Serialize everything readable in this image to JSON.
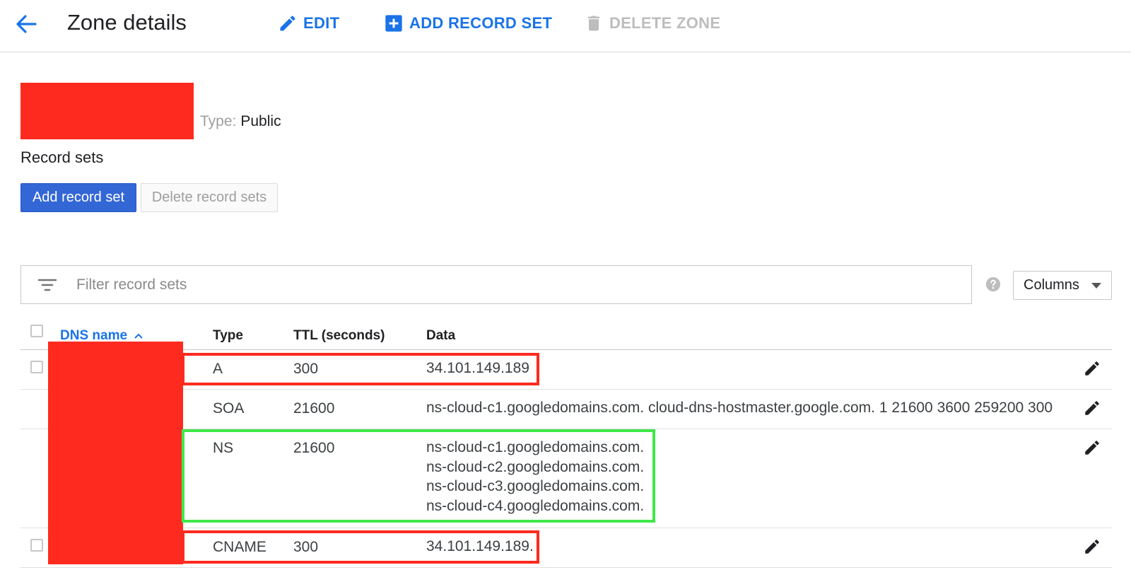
{
  "header": {
    "title": "Zone details",
    "actions": {
      "edit": "EDIT",
      "add_record_set": "ADD RECORD SET",
      "delete_zone": "DELETE ZONE"
    }
  },
  "zone": {
    "type_label": "Type:",
    "type_value": "Public"
  },
  "record_sets": {
    "title": "Record sets",
    "add_button": "Add record set",
    "delete_button": "Delete record sets",
    "filter_placeholder": "Filter record sets",
    "columns_button": "Columns",
    "headers": {
      "dns_name": "DNS name",
      "type": "Type",
      "ttl": "TTL (seconds)",
      "data": "Data"
    },
    "rows": [
      {
        "type": "A",
        "ttl": "300",
        "data": [
          "34.101.149.189"
        ]
      },
      {
        "type": "SOA",
        "ttl": "21600",
        "data": [
          "ns-cloud-c1.googledomains.com. cloud-dns-hostmaster.google.com. 1 21600 3600 259200 300"
        ]
      },
      {
        "type": "NS",
        "ttl": "21600",
        "data": [
          "ns-cloud-c1.googledomains.com.",
          "ns-cloud-c2.googledomains.com.",
          "ns-cloud-c3.googledomains.com.",
          "ns-cloud-c4.googledomains.com."
        ]
      },
      {
        "type": "CNAME",
        "ttl": "300",
        "data": [
          "34.101.149.189."
        ]
      }
    ]
  },
  "colors": {
    "accent": "#1a73e8",
    "primary_button": "#3367d6",
    "redaction": "#ff2a1f",
    "highlight_red": "#ff2a1f",
    "highlight_green": "#3fe84a"
  },
  "icons": {
    "back": "arrow-back-icon",
    "edit": "pencil-icon",
    "add": "add-box-icon",
    "delete": "trash-icon",
    "filter": "filter-list-icon",
    "help": "help-icon",
    "dropdown": "caret-down-icon",
    "sort": "chevron-up-icon"
  }
}
